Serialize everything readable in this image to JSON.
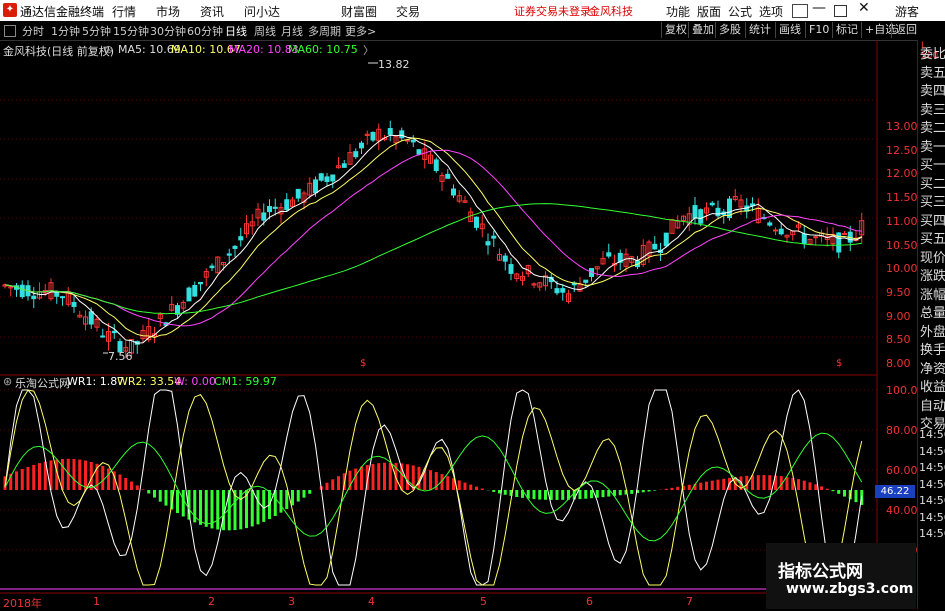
{
  "app": {
    "name": "通达信金融终端"
  },
  "menu": [
    "行情",
    "市场",
    "资讯",
    "问小达",
    "财富圈",
    "交易"
  ],
  "notice": "证券交易未登录",
  "stock_name_top": "金风科技",
  "titlebar_right": [
    "功能",
    "版面",
    "公式",
    "选项"
  ],
  "guest": "游客",
  "timeframes": [
    "分时",
    "1分钟",
    "5分钟",
    "15分钟",
    "30分钟",
    "60分钟",
    "日线",
    "周线",
    "月线",
    "多周期",
    "更多>"
  ],
  "active_timeframe": "日线",
  "toolbar_buttons": [
    "复权",
    "叠加",
    "多股",
    "统计",
    "画线",
    "F10",
    "标记",
    "+自选",
    "返回"
  ],
  "main": {
    "title": "金风科技(日线 前复权)",
    "ma": [
      {
        "label": "MA5: 10.69",
        "color": "#ffffff"
      },
      {
        "label": "MA10: 10.67",
        "color": "#ffff66"
      },
      {
        "label": "MA20: 10.83",
        "color": "#ff44ff"
      },
      {
        "label": "MA60: 10.75",
        "color": "#33ff33"
      }
    ],
    "high_label": "13.82",
    "low_label": "7.56",
    "y_ticks": [
      "13.00",
      "12.50",
      "12.00",
      "11.50",
      "11.00",
      "10.50",
      "10.00",
      "9.50",
      "9.00",
      "8.50",
      "8.00"
    ]
  },
  "indicator": {
    "title": "乐淘公式网",
    "values": [
      {
        "label": "WR1: 1.87",
        "color": "#ffffff"
      },
      {
        "label": "WR2: 33.54",
        "color": "#ffff66"
      },
      {
        "label": "W: 0.00",
        "color": "#ff44ff"
      },
      {
        "label": "CM1: 59.97",
        "color": "#33ff33"
      }
    ],
    "y_ticks": [
      "100.0",
      "80.00",
      "60.00",
      "40.00",
      "20.00"
    ],
    "current_value": "46.22"
  },
  "time_axis": [
    "2018年",
    "1",
    "2",
    "3",
    "4",
    "5",
    "6",
    "7"
  ],
  "side_panel_top": "L 500",
  "side_panel": [
    "委比",
    "卖五",
    "卖四",
    "卖三",
    "卖二",
    "卖一",
    "买一",
    "买二",
    "买三",
    "买四",
    "买五",
    "现价",
    "涨跌",
    "涨幅",
    "总量",
    "外盘",
    "换手",
    "净资",
    "收益",
    "自动",
    "交易"
  ],
  "side_times": [
    "14:56",
    "14:56",
    "14:56",
    "14:56",
    "14:56",
    "14:56",
    "14:56"
  ],
  "watermark": {
    "line1": "指标公式网",
    "line2": "www.zbgs3.com"
  },
  "colors": {
    "up": "#ff3333",
    "down": "#33e0e0",
    "ma5": "#ffffff",
    "ma10": "#ffff66",
    "ma20": "#ff44ff",
    "ma60": "#33ff33",
    "macd_pos": "#ff2222",
    "macd_neg": "#33ff33"
  }
}
